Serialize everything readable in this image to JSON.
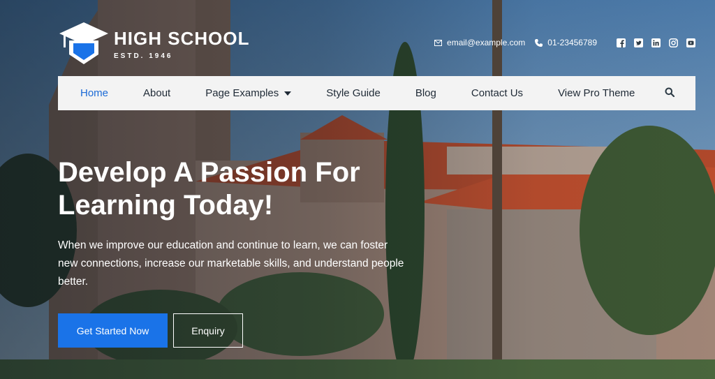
{
  "brand": {
    "name": "HIGH SCHOOL",
    "tagline": "ESTD. 1946",
    "logo_icon": "graduation-cap-icon",
    "accent_color": "#1a73e8"
  },
  "contact": {
    "email": "email@example.com",
    "phone": "01-23456789",
    "email_icon": "envelope-icon",
    "phone_icon": "phone-icon"
  },
  "socials": [
    "facebook-icon",
    "twitter-icon",
    "linkedin-icon",
    "instagram-icon",
    "youtube-icon"
  ],
  "nav": {
    "items": [
      {
        "label": "Home",
        "active": true
      },
      {
        "label": "About"
      },
      {
        "label": "Page Examples",
        "dropdown": true
      },
      {
        "label": "Style Guide"
      },
      {
        "label": "Blog"
      },
      {
        "label": "Contact Us"
      },
      {
        "label": "View Pro Theme"
      }
    ],
    "search_icon": "search-icon"
  },
  "hero": {
    "headline_line1": "Develop A Passion For",
    "headline_line2": "Learning Today!",
    "lead": "When we improve our education and continue to learn, we can foster new connections, increase our marketable skills, and understand people better.",
    "primary_button": "Get Started Now",
    "secondary_button": "Enquiry"
  }
}
